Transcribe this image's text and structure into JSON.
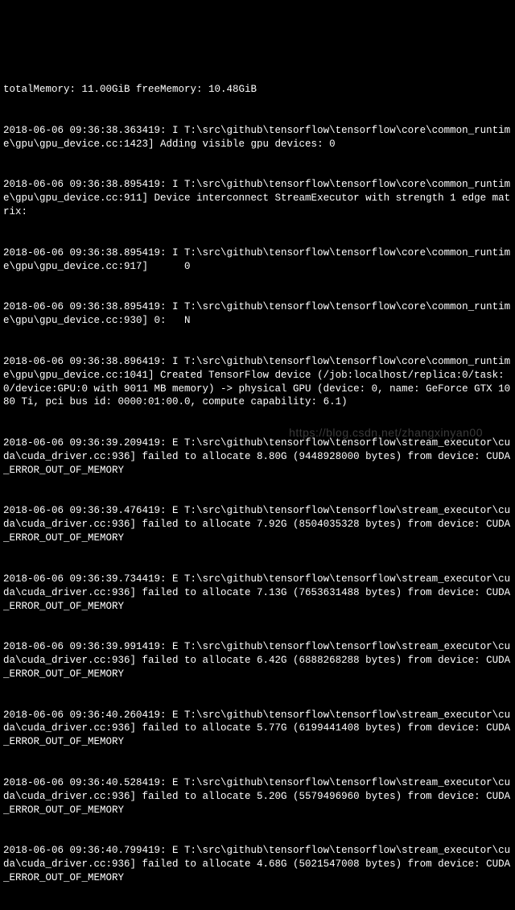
{
  "terminal": {
    "lines": [
      "totalMemory: 11.00GiB freeMemory: 10.48GiB",
      "2018-06-06 09:36:38.363419: I T:\\src\\github\\tensorflow\\tensorflow\\core\\common_runtime\\gpu\\gpu_device.cc:1423] Adding visible gpu devices: 0",
      "2018-06-06 09:36:38.895419: I T:\\src\\github\\tensorflow\\tensorflow\\core\\common_runtime\\gpu\\gpu_device.cc:911] Device interconnect StreamExecutor with strength 1 edge matrix:",
      "2018-06-06 09:36:38.895419: I T:\\src\\github\\tensorflow\\tensorflow\\core\\common_runtime\\gpu\\gpu_device.cc:917]      0",
      "2018-06-06 09:36:38.895419: I T:\\src\\github\\tensorflow\\tensorflow\\core\\common_runtime\\gpu\\gpu_device.cc:930] 0:   N",
      "2018-06-06 09:36:38.896419: I T:\\src\\github\\tensorflow\\tensorflow\\core\\common_runtime\\gpu\\gpu_device.cc:1041] Created TensorFlow device (/job:localhost/replica:0/task:0/device:GPU:0 with 9011 MB memory) -> physical GPU (device: 0, name: GeForce GTX 1080 Ti, pci bus id: 0000:01:00.0, compute capability: 6.1)",
      "2018-06-06 09:36:39.209419: E T:\\src\\github\\tensorflow\\tensorflow\\stream_executor\\cuda\\cuda_driver.cc:936] failed to allocate 8.80G (9448928000 bytes) from device: CUDA_ERROR_OUT_OF_MEMORY",
      "2018-06-06 09:36:39.476419: E T:\\src\\github\\tensorflow\\tensorflow\\stream_executor\\cuda\\cuda_driver.cc:936] failed to allocate 7.92G (8504035328 bytes) from device: CUDA_ERROR_OUT_OF_MEMORY",
      "2018-06-06 09:36:39.734419: E T:\\src\\github\\tensorflow\\tensorflow\\stream_executor\\cuda\\cuda_driver.cc:936] failed to allocate 7.13G (7653631488 bytes) from device: CUDA_ERROR_OUT_OF_MEMORY",
      "2018-06-06 09:36:39.991419: E T:\\src\\github\\tensorflow\\tensorflow\\stream_executor\\cuda\\cuda_driver.cc:936] failed to allocate 6.42G (6888268288 bytes) from device: CUDA_ERROR_OUT_OF_MEMORY",
      "2018-06-06 09:36:40.260419: E T:\\src\\github\\tensorflow\\tensorflow\\stream_executor\\cuda\\cuda_driver.cc:936] failed to allocate 5.77G (6199441408 bytes) from device: CUDA_ERROR_OUT_OF_MEMORY",
      "2018-06-06 09:36:40.528419: E T:\\src\\github\\tensorflow\\tensorflow\\stream_executor\\cuda\\cuda_driver.cc:936] failed to allocate 5.20G (5579496960 bytes) from device: CUDA_ERROR_OUT_OF_MEMORY",
      "2018-06-06 09:36:40.799419: E T:\\src\\github\\tensorflow\\tensorflow\\stream_executor\\cuda\\cuda_driver.cc:936] failed to allocate 4.68G (5021547008 bytes) from device: CUDA_ERROR_OUT_OF_MEMORY"
    ]
  },
  "watermark": "https://blog.csdn.net/zhangxinyan00"
}
